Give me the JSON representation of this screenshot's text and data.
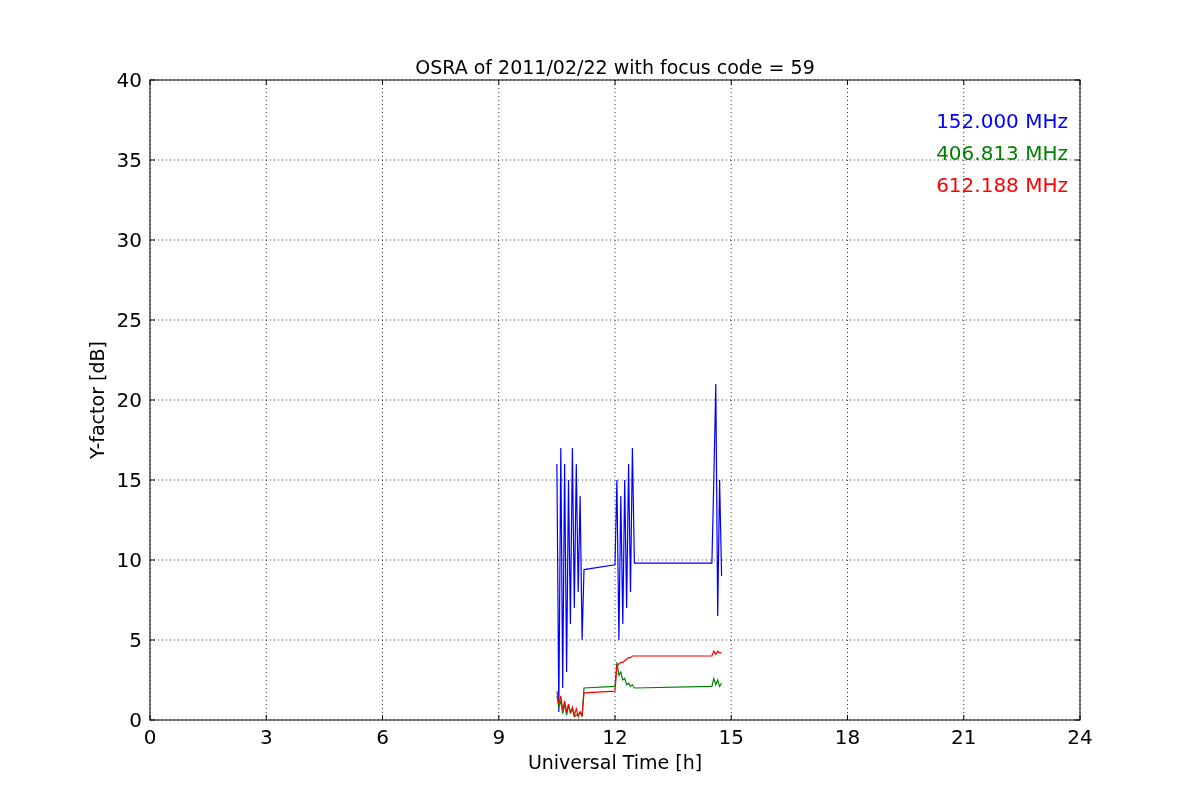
{
  "chart_data": {
    "type": "line",
    "title": "OSRA of 2011/02/22 with focus code = 59",
    "xlabel": "Universal Time [h]",
    "ylabel": "Y-factor [dB]",
    "x": [
      10.5,
      10.55,
      10.6,
      10.65,
      10.7,
      10.75,
      10.8,
      10.85,
      10.9,
      10.95,
      11.0,
      11.05,
      11.1,
      11.15,
      11.2,
      12.0,
      12.05,
      12.1,
      12.15,
      12.2,
      12.25,
      12.3,
      12.35,
      12.4,
      12.45,
      12.5,
      14.5,
      14.55,
      14.6,
      14.65,
      14.7,
      14.75
    ],
    "series": [
      {
        "name": "152.000 MHz",
        "color": "#0000ff",
        "values": [
          16,
          0.5,
          17,
          2,
          16,
          3,
          15,
          6,
          17,
          7,
          16,
          8,
          14,
          5,
          9.4,
          9.7,
          15,
          5,
          14,
          6,
          15,
          7,
          16,
          8,
          17,
          9.8,
          9.8,
          15,
          21,
          6.5,
          15,
          9
        ]
      },
      {
        "name": "406.813 MHz",
        "color": "#008000",
        "values": [
          1.5,
          0.8,
          1.2,
          0.4,
          1.0,
          0.3,
          0.9,
          0.5,
          0.7,
          0.2,
          0.3,
          0.3,
          0.5,
          0.2,
          2.0,
          2.1,
          3.6,
          2.8,
          3.0,
          2.5,
          2.6,
          2.2,
          2.3,
          2.1,
          2.2,
          2.0,
          2.1,
          2.6,
          2.2,
          2.5,
          2.1,
          2.3
        ]
      },
      {
        "name": "612.188 MHz",
        "color": "#ff0000",
        "values": [
          1.8,
          1.0,
          1.5,
          0.6,
          1.2,
          0.5,
          1.0,
          0.4,
          0.8,
          0.3,
          0.7,
          0.2,
          0.5,
          0.3,
          1.7,
          1.8,
          3.4,
          3.5,
          3.6,
          3.6,
          3.7,
          3.8,
          3.9,
          3.9,
          4.0,
          4.0,
          4.0,
          4.3,
          4.1,
          4.3,
          4.2,
          4.2
        ]
      }
    ],
    "grid": true,
    "xlim": [
      0,
      24
    ],
    "ylim": [
      0,
      40
    ],
    "xticks": [
      0,
      3,
      6,
      9,
      12,
      15,
      18,
      21,
      24
    ],
    "yticks": [
      0,
      5,
      10,
      15,
      20,
      25,
      30,
      35,
      40
    ]
  }
}
